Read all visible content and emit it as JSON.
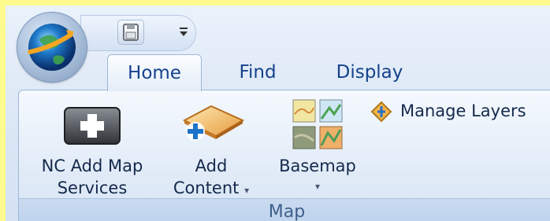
{
  "quick_access": {
    "save_icon": "save-icon",
    "customize_icon": "qat-dropdown-icon"
  },
  "tabs": [
    {
      "label": "Home",
      "active": true
    },
    {
      "label": "Find",
      "active": false
    },
    {
      "label": "Display",
      "active": false
    }
  ],
  "ribbon": {
    "group_label": "Map",
    "nc_add_map_services": {
      "line1": "NC Add Map",
      "line2": "Services"
    },
    "add_content": {
      "line1": "Add",
      "line2": "Content",
      "dropdown": "▾"
    },
    "basemap": {
      "label": "Basemap",
      "dropdown": "▾"
    },
    "manage_layers": {
      "label": "Manage Layers"
    }
  },
  "colors": {
    "background": "#fdfb8e",
    "tab_text": "#15428b",
    "label_text": "#15294c"
  }
}
